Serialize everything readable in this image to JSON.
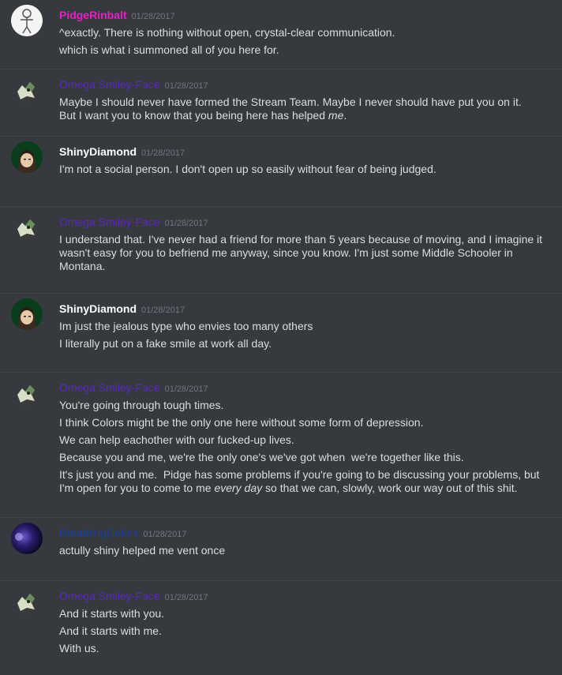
{
  "colors": {
    "background": "#36393e",
    "text": "#dcddde",
    "timestamp": "#72767d",
    "pidge": "#e91ec8",
    "omega": "#5b27c2",
    "shiny": "#ffffff",
    "breathing": "#1c3f9e"
  },
  "messages": [
    {
      "username": "PidgeRinbalt",
      "timestamp": "01/28/2017",
      "avatar": "white-figure-avatar",
      "lines": [
        "^exactly. There is nothing without open, crystal-clear communication.",
        "which is what i summoned all of you here for."
      ]
    },
    {
      "username": "Omega Smiley-Face",
      "timestamp": "01/28/2017",
      "avatar": "creature-avatar",
      "lines": [
        "Maybe I should never have formed the Stream Team. Maybe I never should have put you on it.",
        "But I want you to know that you being here has helped",
        "me",
        "."
      ]
    },
    {
      "username": "ShinyDiamond",
      "timestamp": "01/28/2017",
      "avatar": "anime-boy-avatar",
      "lines": [
        "I'm not a social person. I don't open up so easily without fear of being judged."
      ]
    },
    {
      "username": "Omega Smiley-Face",
      "timestamp": "01/28/2017",
      "avatar": "creature-avatar",
      "lines": [
        "I understand that. I've never had a friend for more than 5 years because of moving, and I imagine it wasn't easy for you to befriend me anyway, since you know. I'm just some Middle Schooler in Montana."
      ]
    },
    {
      "username": "ShinyDiamond",
      "timestamp": "01/28/2017",
      "avatar": "anime-boy-avatar",
      "lines": [
        "Im just the jealous type who envies too many others",
        "I literally put on a fake smile at work all day."
      ]
    },
    {
      "username": "Omega Smiley-Face",
      "timestamp": "01/28/2017",
      "avatar": "creature-avatar",
      "lines": [
        "You're going through tough times.",
        "I think Colors might be the only one here without some form of depression.",
        "We can help eachother with our fucked-up lives.",
        "Because you and me, we're the only one's we've got when  we're together like this.",
        "It's just you and me.  Pidge has some problems if you're going to be discussing your problems, but I'm open for you to come to me",
        "every day",
        "so that we can, slowly, work our way out of this shit."
      ]
    },
    {
      "username": "BreathingColors",
      "timestamp": "01/28/2017",
      "avatar": "dark-purple-avatar",
      "lines": [
        "actully shiny helped me vent once"
      ]
    },
    {
      "username": "Omega Smiley-Face",
      "timestamp": "01/28/2017",
      "avatar": "creature-avatar",
      "lines": [
        "And it starts with you.",
        "And it starts with me.",
        "With us."
      ]
    }
  ]
}
